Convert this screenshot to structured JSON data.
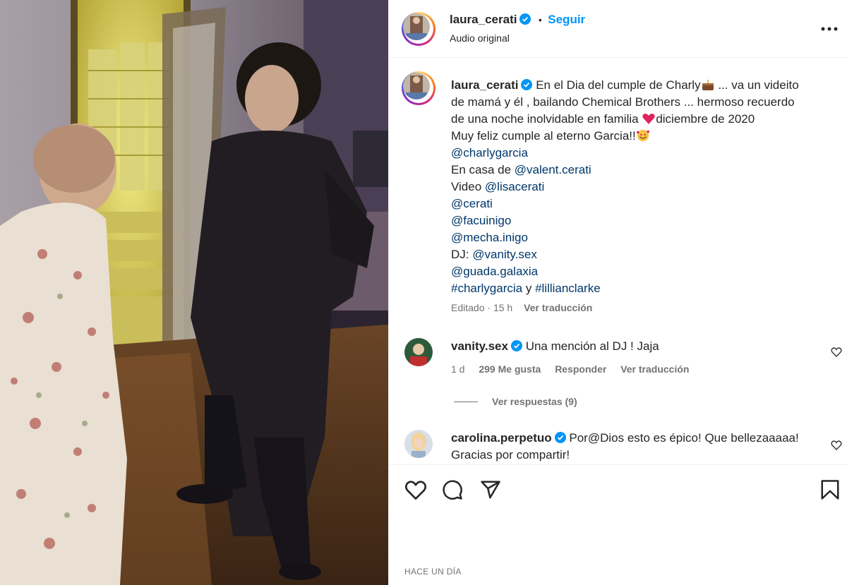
{
  "post": {
    "author": "laura_cerati",
    "follow_label": "Seguir",
    "separator": "•",
    "audio": "Audio original"
  },
  "caption": {
    "author": "laura_cerati",
    "line1": "En el Dia del cumple de Charly",
    "line1_tail": " ... va un videito",
    "line2": "de mamá y él , bailando Chemical Brothers ... hermoso recuerdo",
    "line3": "de una noche inolvidable en familia ",
    "line3_tail": "diciembre de 2020",
    "line4": "Muy feliz cumple al eterno Garcia!!",
    "mention_charly": "@charlygarcia",
    "en_casa": "En casa de ",
    "mention_valent": "@valent.cerati",
    "video": "Video ",
    "mention_lisa": "@lisacerati",
    "mention_cerati": "@cerati",
    "mention_facu": "@facuinigo",
    "mention_mecha": "@mecha.inigo",
    "dj": "DJ: ",
    "mention_vanity": "@vanity.sex",
    "mention_guada": "@guada.galaxia",
    "hashtag_charly": "#charlygarcia",
    "y": " y ",
    "hashtag_lillian": "#lillianclarke",
    "edited": "Editado",
    "dot": "·",
    "time": "15 h",
    "translate": "Ver traducción"
  },
  "comments": [
    {
      "user": "vanity.sex",
      "text": "Una mención al DJ ! Jaja",
      "age": "1 d",
      "likes": "299 Me gusta",
      "reply": "Responder",
      "translate": "Ver traducción",
      "view_replies": "Ver respuestas (9)"
    },
    {
      "user": "carolina.perpetuo",
      "text": "Por@Dios esto es épico! Que bellezaaaaa!",
      "text2": "Gracias por compartir!"
    }
  ],
  "footer": {
    "date": "HACE UN DÍA"
  },
  "colors": {
    "link": "#00376b",
    "follow": "#0095f6",
    "verified": "#0095f6",
    "muted": "#737373"
  },
  "icons": [
    "verified-icon",
    "more-options-icon",
    "like-icon",
    "comment-icon",
    "share-icon",
    "save-icon",
    "comment-like-icon",
    "cake-emoji",
    "heart-emoji",
    "smiling-hearts-emoji"
  ]
}
